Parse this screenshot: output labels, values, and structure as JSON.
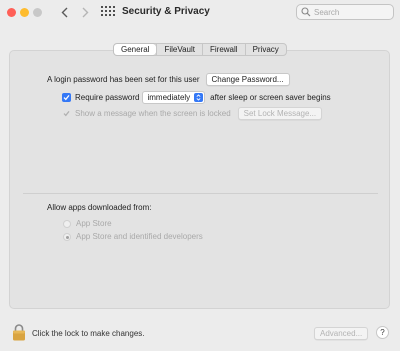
{
  "window": {
    "title": "Security & Privacy"
  },
  "search": {
    "placeholder": "Search"
  },
  "tabs": [
    {
      "label": "General",
      "active": true
    },
    {
      "label": "FileVault",
      "active": false
    },
    {
      "label": "Firewall",
      "active": false
    },
    {
      "label": "Privacy",
      "active": false
    }
  ],
  "general": {
    "login_text": "A login password has been set for this user",
    "change_password_label": "Change Password...",
    "require_password_label": "Require password",
    "require_password_checked": true,
    "require_password_value": "immediately",
    "require_password_suffix": "after sleep or screen saver begins",
    "show_message_label": "Show a message when the screen is locked",
    "show_message_checked": true,
    "set_lock_message_label": "Set Lock Message..."
  },
  "allow_apps": {
    "heading": "Allow apps downloaded from:",
    "options": [
      {
        "label": "App Store",
        "selected": false
      },
      {
        "label": "App Store and identified developers",
        "selected": true
      }
    ]
  },
  "footer": {
    "lock_text": "Click the lock to make changes.",
    "advanced_label": "Advanced...",
    "help_label": "?"
  },
  "icons": {
    "lock": "lock-icon",
    "search": "search-icon",
    "back": "chevron-left-icon",
    "forward": "chevron-right-icon",
    "grid": "grid-icon"
  },
  "colors": {
    "accent": "#3478f6",
    "close": "#ff5f57",
    "minimize": "#febc2e",
    "lock": "#d9a441"
  }
}
